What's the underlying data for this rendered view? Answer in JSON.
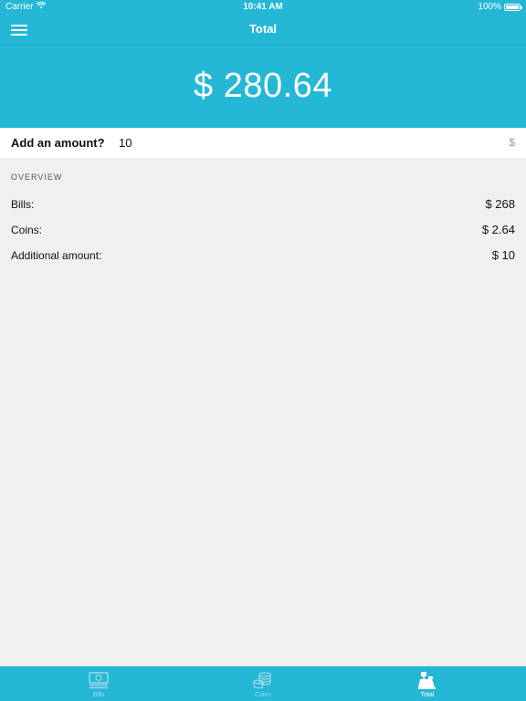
{
  "status_bar": {
    "carrier": "Carrier",
    "time": "10:41 AM",
    "battery": "100%"
  },
  "nav": {
    "title": "Total"
  },
  "total": {
    "amount": "$ 280.64"
  },
  "add_amount": {
    "label": "Add an amount?",
    "value": "10",
    "currency": "$"
  },
  "overview": {
    "header": "OVERVIEW",
    "rows": [
      {
        "label": "Bills:",
        "value": "$ 268"
      },
      {
        "label": "Coins:",
        "value": "$ 2.64"
      },
      {
        "label": "Additional amount:",
        "value": "$ 10"
      }
    ]
  },
  "tabs": [
    {
      "label": "Bills",
      "icon": "bills-icon",
      "active": false
    },
    {
      "label": "Coins",
      "icon": "coins-icon",
      "active": false
    },
    {
      "label": "Total",
      "icon": "cash-register-icon",
      "active": true
    }
  ],
  "colors": {
    "accent": "#25b7d6",
    "background": "#f0f0f0",
    "tab_inactive": "#9edcea"
  }
}
